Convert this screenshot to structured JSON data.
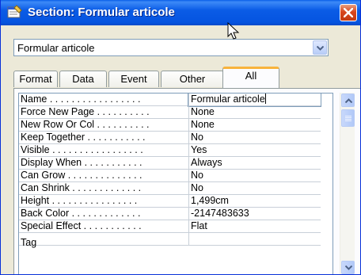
{
  "window": {
    "title": "Section: Formular articole"
  },
  "object_selector": {
    "value": "Formular articole"
  },
  "tabs": [
    {
      "label": "Format"
    },
    {
      "label": "Data"
    },
    {
      "label": "Event"
    },
    {
      "label": "Other"
    },
    {
      "label": "All",
      "active": true
    }
  ],
  "properties": [
    {
      "name": "Name . . . . . . . . . . . . . . . . .",
      "value": "Formular articole"
    },
    {
      "name": "Force New Page . . . . . . . . . .",
      "value": "None"
    },
    {
      "name": "New Row Or Col . . . . . . . . . .",
      "value": "None"
    },
    {
      "name": "Keep Together . . . . . . . . . . .",
      "value": "No"
    },
    {
      "name": "Visible . . . . . . . . . . . . . . . . .",
      "value": "Yes"
    },
    {
      "name": "Display When . . . . . . . . . . .",
      "value": "Always"
    },
    {
      "name": "Can Grow . . . . . . . . . . . . . .",
      "value": "No"
    },
    {
      "name": "Can Shrink . . . . . . . . . . . . .",
      "value": "No"
    },
    {
      "name": "Height . . . . . . . . . . . . . . . .",
      "value": "1,499cm"
    },
    {
      "name": "Back Color . . . . . . . . . . . . .",
      "value": "-2147483633"
    },
    {
      "name": "Special Effect . . . . . . . . . . .",
      "value": "Flat"
    },
    {
      "name": "Tag",
      "value": ""
    }
  ],
  "colors": {
    "titlebar": "#0554e0",
    "active_tab_accent": "#f8b33c",
    "close_button": "#d8461c"
  }
}
